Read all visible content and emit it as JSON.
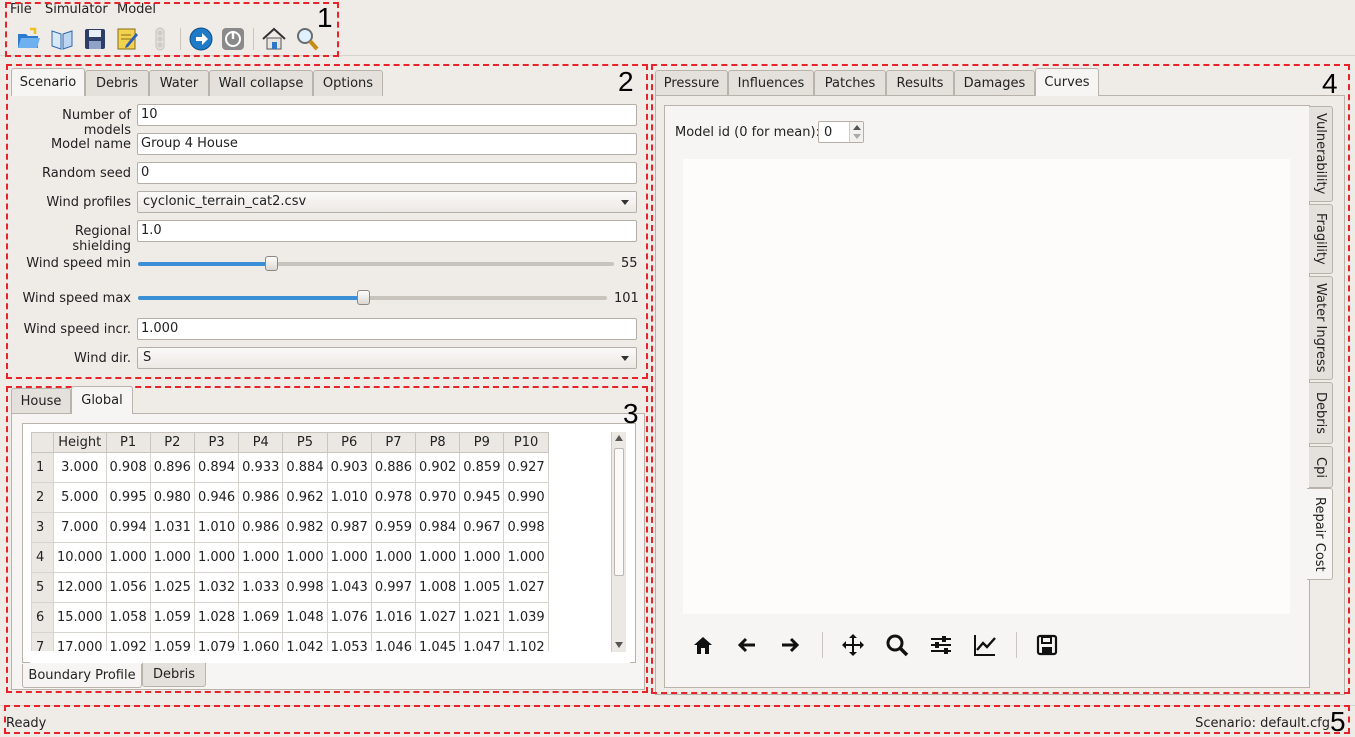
{
  "menu": {
    "file": "File",
    "simulator": "Simulator",
    "model": "Model"
  },
  "toolbar": {
    "icons": [
      "open-folder",
      "open-book",
      "save",
      "edit",
      "stop-light",
      "run",
      "power",
      "home",
      "search"
    ]
  },
  "callouts": [
    "1",
    "2",
    "3",
    "4",
    "5"
  ],
  "left_tabs": [
    "Scenario",
    "Debris",
    "Water",
    "Wall collapse",
    "Options"
  ],
  "scenario": {
    "num_models_label": "Number of models",
    "num_models": "10",
    "model_name_label": "Model name",
    "model_name": "Group 4 House",
    "random_seed_label": "Random seed",
    "random_seed": "0",
    "wind_profiles_label": "Wind profiles",
    "wind_profiles": "cyclonic_terrain_cat2.csv",
    "regional_shielding_label": "Regional shielding",
    "regional_shielding": "1.0",
    "wind_speed_min_label": "Wind speed min",
    "wind_speed_min": "55",
    "wind_speed_min_fraction": 0.28,
    "wind_speed_max_label": "Wind speed max",
    "wind_speed_max": "101",
    "wind_speed_max_fraction": 0.48,
    "wind_speed_incr_label": "Wind speed incr.",
    "wind_speed_incr": "1.000",
    "wind_dir_label": "Wind dir.",
    "wind_dir": "S"
  },
  "lower_tabs": [
    "House",
    "Global"
  ],
  "boundary_table": {
    "columns": [
      "Height",
      "P1",
      "P2",
      "P3",
      "P4",
      "P5",
      "P6",
      "P7",
      "P8",
      "P9",
      "P10"
    ],
    "rows": [
      {
        "n": "1",
        "cells": [
          "3.000",
          "0.908",
          "0.896",
          "0.894",
          "0.933",
          "0.884",
          "0.903",
          "0.886",
          "0.902",
          "0.859",
          "0.927"
        ]
      },
      {
        "n": "2",
        "cells": [
          "5.000",
          "0.995",
          "0.980",
          "0.946",
          "0.986",
          "0.962",
          "1.010",
          "0.978",
          "0.970",
          "0.945",
          "0.990"
        ]
      },
      {
        "n": "3",
        "cells": [
          "7.000",
          "0.994",
          "1.031",
          "1.010",
          "0.986",
          "0.982",
          "0.987",
          "0.959",
          "0.984",
          "0.967",
          "0.998"
        ]
      },
      {
        "n": "4",
        "cells": [
          "10.000",
          "1.000",
          "1.000",
          "1.000",
          "1.000",
          "1.000",
          "1.000",
          "1.000",
          "1.000",
          "1.000",
          "1.000"
        ]
      },
      {
        "n": "5",
        "cells": [
          "12.000",
          "1.056",
          "1.025",
          "1.032",
          "1.033",
          "0.998",
          "1.043",
          "0.997",
          "1.008",
          "1.005",
          "1.027"
        ]
      },
      {
        "n": "6",
        "cells": [
          "15.000",
          "1.058",
          "1.059",
          "1.028",
          "1.069",
          "1.048",
          "1.076",
          "1.016",
          "1.027",
          "1.021",
          "1.039"
        ]
      },
      {
        "n": "7",
        "cells": [
          "17.000",
          "1.092",
          "1.059",
          "1.079",
          "1.060",
          "1.042",
          "1.053",
          "1.046",
          "1.045",
          "1.047",
          "1.102"
        ]
      }
    ]
  },
  "bottom_tabs": [
    "Boundary Profile",
    "Debris"
  ],
  "right_tabs": [
    "Pressure",
    "Influences",
    "Patches",
    "Results",
    "Damages",
    "Curves"
  ],
  "curves": {
    "model_id_label": "Model id (0 for mean):",
    "model_id": "0"
  },
  "vertical_tabs": [
    "Vulnerability",
    "Fragility",
    "Water Ingress",
    "Debris",
    "Cpi",
    "Repair Cost"
  ],
  "plot_toolbar": [
    "home",
    "back",
    "forward",
    "pan",
    "zoom",
    "configure",
    "edit-curves",
    "save"
  ],
  "status": {
    "left": "Ready",
    "right": "Scenario: default.cfg"
  }
}
